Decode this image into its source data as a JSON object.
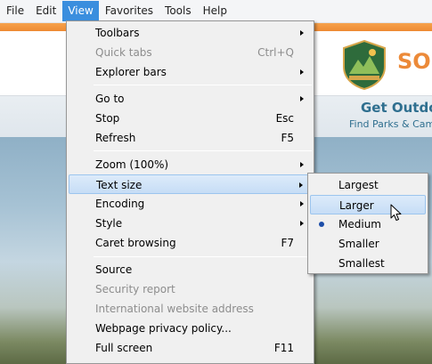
{
  "menubar": {
    "items": [
      {
        "label": "File"
      },
      {
        "label": "Edit"
      },
      {
        "label": "View"
      },
      {
        "label": "Favorites"
      },
      {
        "label": "Tools"
      },
      {
        "label": "Help"
      }
    ],
    "active_index": 2
  },
  "page": {
    "logo_text": "SON",
    "promo_title": "Get Outdo",
    "promo_sub": "Find Parks & Camp"
  },
  "view_menu": {
    "items": [
      {
        "label": "Toolbars",
        "shortcut": "",
        "submenu": true,
        "disabled": false
      },
      {
        "label": "Quick tabs",
        "shortcut": "Ctrl+Q",
        "submenu": false,
        "disabled": true
      },
      {
        "label": "Explorer bars",
        "shortcut": "",
        "submenu": true,
        "disabled": false
      },
      {
        "label": "Go to",
        "shortcut": "",
        "submenu": true,
        "disabled": false
      },
      {
        "label": "Stop",
        "shortcut": "Esc",
        "submenu": false,
        "disabled": false
      },
      {
        "label": "Refresh",
        "shortcut": "F5",
        "submenu": false,
        "disabled": false
      },
      {
        "label": "Zoom (100%)",
        "shortcut": "",
        "submenu": true,
        "disabled": false
      },
      {
        "label": "Text size",
        "shortcut": "",
        "submenu": true,
        "disabled": false,
        "highlighted": true
      },
      {
        "label": "Encoding",
        "shortcut": "",
        "submenu": true,
        "disabled": false
      },
      {
        "label": "Style",
        "shortcut": "",
        "submenu": true,
        "disabled": false
      },
      {
        "label": "Caret browsing",
        "shortcut": "F7",
        "submenu": false,
        "disabled": false
      },
      {
        "label": "Source",
        "shortcut": "",
        "submenu": false,
        "disabled": false
      },
      {
        "label": "Security report",
        "shortcut": "",
        "submenu": false,
        "disabled": true
      },
      {
        "label": "International website address",
        "shortcut": "",
        "submenu": false,
        "disabled": true
      },
      {
        "label": "Webpage privacy policy...",
        "shortcut": "",
        "submenu": false,
        "disabled": false
      },
      {
        "label": "Full screen",
        "shortcut": "F11",
        "submenu": false,
        "disabled": false
      }
    ]
  },
  "text_size_menu": {
    "items": [
      {
        "label": "Largest"
      },
      {
        "label": "Larger"
      },
      {
        "label": "Medium"
      },
      {
        "label": "Smaller"
      },
      {
        "label": "Smallest"
      }
    ],
    "selected": "Medium",
    "hovered": "Larger"
  },
  "colors": {
    "menu_highlight": "#3a8ede",
    "brand_orange": "#ec8a39",
    "brand_green": "#2e6b3b",
    "promo_blue": "#2f6f8f",
    "radio_dot": "#1d4ea8"
  },
  "icons": [
    "regional-parks-badge-icon",
    "submenu-arrow-icon",
    "radio-dot-icon",
    "mouse-pointer-icon"
  ]
}
